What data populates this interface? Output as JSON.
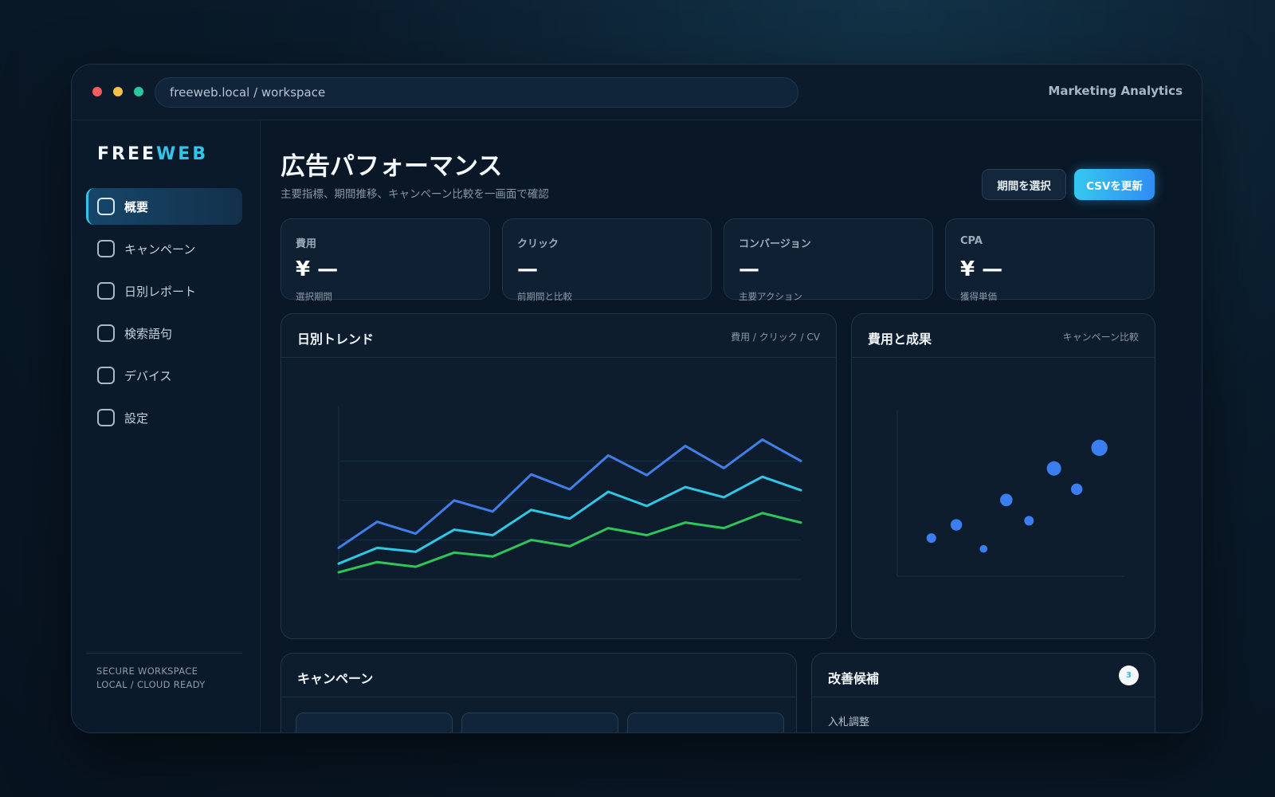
{
  "window": {
    "url": "freeweb.local / workspace",
    "app_title": "Marketing Analytics"
  },
  "sidebar": {
    "logo_part1": "FREE",
    "logo_part2": "WEB",
    "items": [
      {
        "label": "概要",
        "active": true
      },
      {
        "label": "キャンペーン",
        "active": false
      },
      {
        "label": "日別レポート",
        "active": false
      },
      {
        "label": "検索語句",
        "active": false
      },
      {
        "label": "デバイス",
        "active": false
      },
      {
        "label": "設定",
        "active": false
      }
    ],
    "footer_line1": "SECURE WORKSPACE",
    "footer_line2": "LOCAL / CLOUD READY"
  },
  "header": {
    "title": "広告パフォーマンス",
    "subtitle": "主要指標、期間推移、キャンペーン比較を一画面で確認",
    "period_button": "期間を選択",
    "csv_button": "CSVを更新"
  },
  "kpis": [
    {
      "label": "費用",
      "value": "¥ —",
      "sub": "選択期間"
    },
    {
      "label": "クリック",
      "value": "—",
      "sub": "前期間と比較"
    },
    {
      "label": "コンバージョン",
      "value": "—",
      "sub": "主要アクション"
    },
    {
      "label": "CPA",
      "value": "¥ —",
      "sub": "獲得単価"
    }
  ],
  "trend_panel": {
    "title": "日別トレンド",
    "note": "費用 / クリック / CV"
  },
  "scatter_panel": {
    "title": "費用と成果",
    "note": "キャンペーン比較"
  },
  "campaign_panel": {
    "title": "キャンペーン"
  },
  "improve_panel": {
    "title": "改善候補",
    "count": "3",
    "first_item": "入札調整"
  },
  "colors": {
    "accent": "#35c3ea",
    "series_blue": "#3f7fe8",
    "series_cyan": "#2ec8e6",
    "series_green": "#2ec65a",
    "scatter_point": "#3a7ef0"
  },
  "chart_data": [
    {
      "type": "line",
      "x": [
        1,
        2,
        3,
        4,
        5,
        6,
        7,
        8,
        9,
        10,
        11,
        12,
        13
      ],
      "series": [
        {
          "values": [
            40,
            73,
            58,
            100,
            86,
            133,
            114,
            157,
            132,
            169,
            141,
            177,
            150
          ]
        },
        {
          "values": [
            20,
            40,
            35,
            63,
            56,
            88,
            77,
            111,
            93,
            117,
            104,
            130,
            113
          ]
        },
        {
          "values": [
            9,
            22,
            16,
            34,
            29,
            50,
            42,
            65,
            56,
            72,
            65,
            84,
            72
          ]
        }
      ],
      "ylim": [
        0,
        220
      ],
      "grid": true
    },
    {
      "type": "scatter",
      "points": [
        {
          "x": 1.5,
          "y": 4.6,
          "size": 1
        },
        {
          "x": 2.6,
          "y": 6.2,
          "size": 1.2
        },
        {
          "x": 3.8,
          "y": 3.3,
          "size": 0.8
        },
        {
          "x": 4.8,
          "y": 9.2,
          "size": 1.3
        },
        {
          "x": 5.8,
          "y": 6.7,
          "size": 1
        },
        {
          "x": 6.9,
          "y": 13.0,
          "size": 1.5
        },
        {
          "x": 7.9,
          "y": 10.5,
          "size": 1.2
        },
        {
          "x": 8.9,
          "y": 15.5,
          "size": 1.7
        }
      ],
      "xlim": [
        0,
        10
      ],
      "ylim": [
        0,
        20
      ],
      "grid": false
    }
  ]
}
